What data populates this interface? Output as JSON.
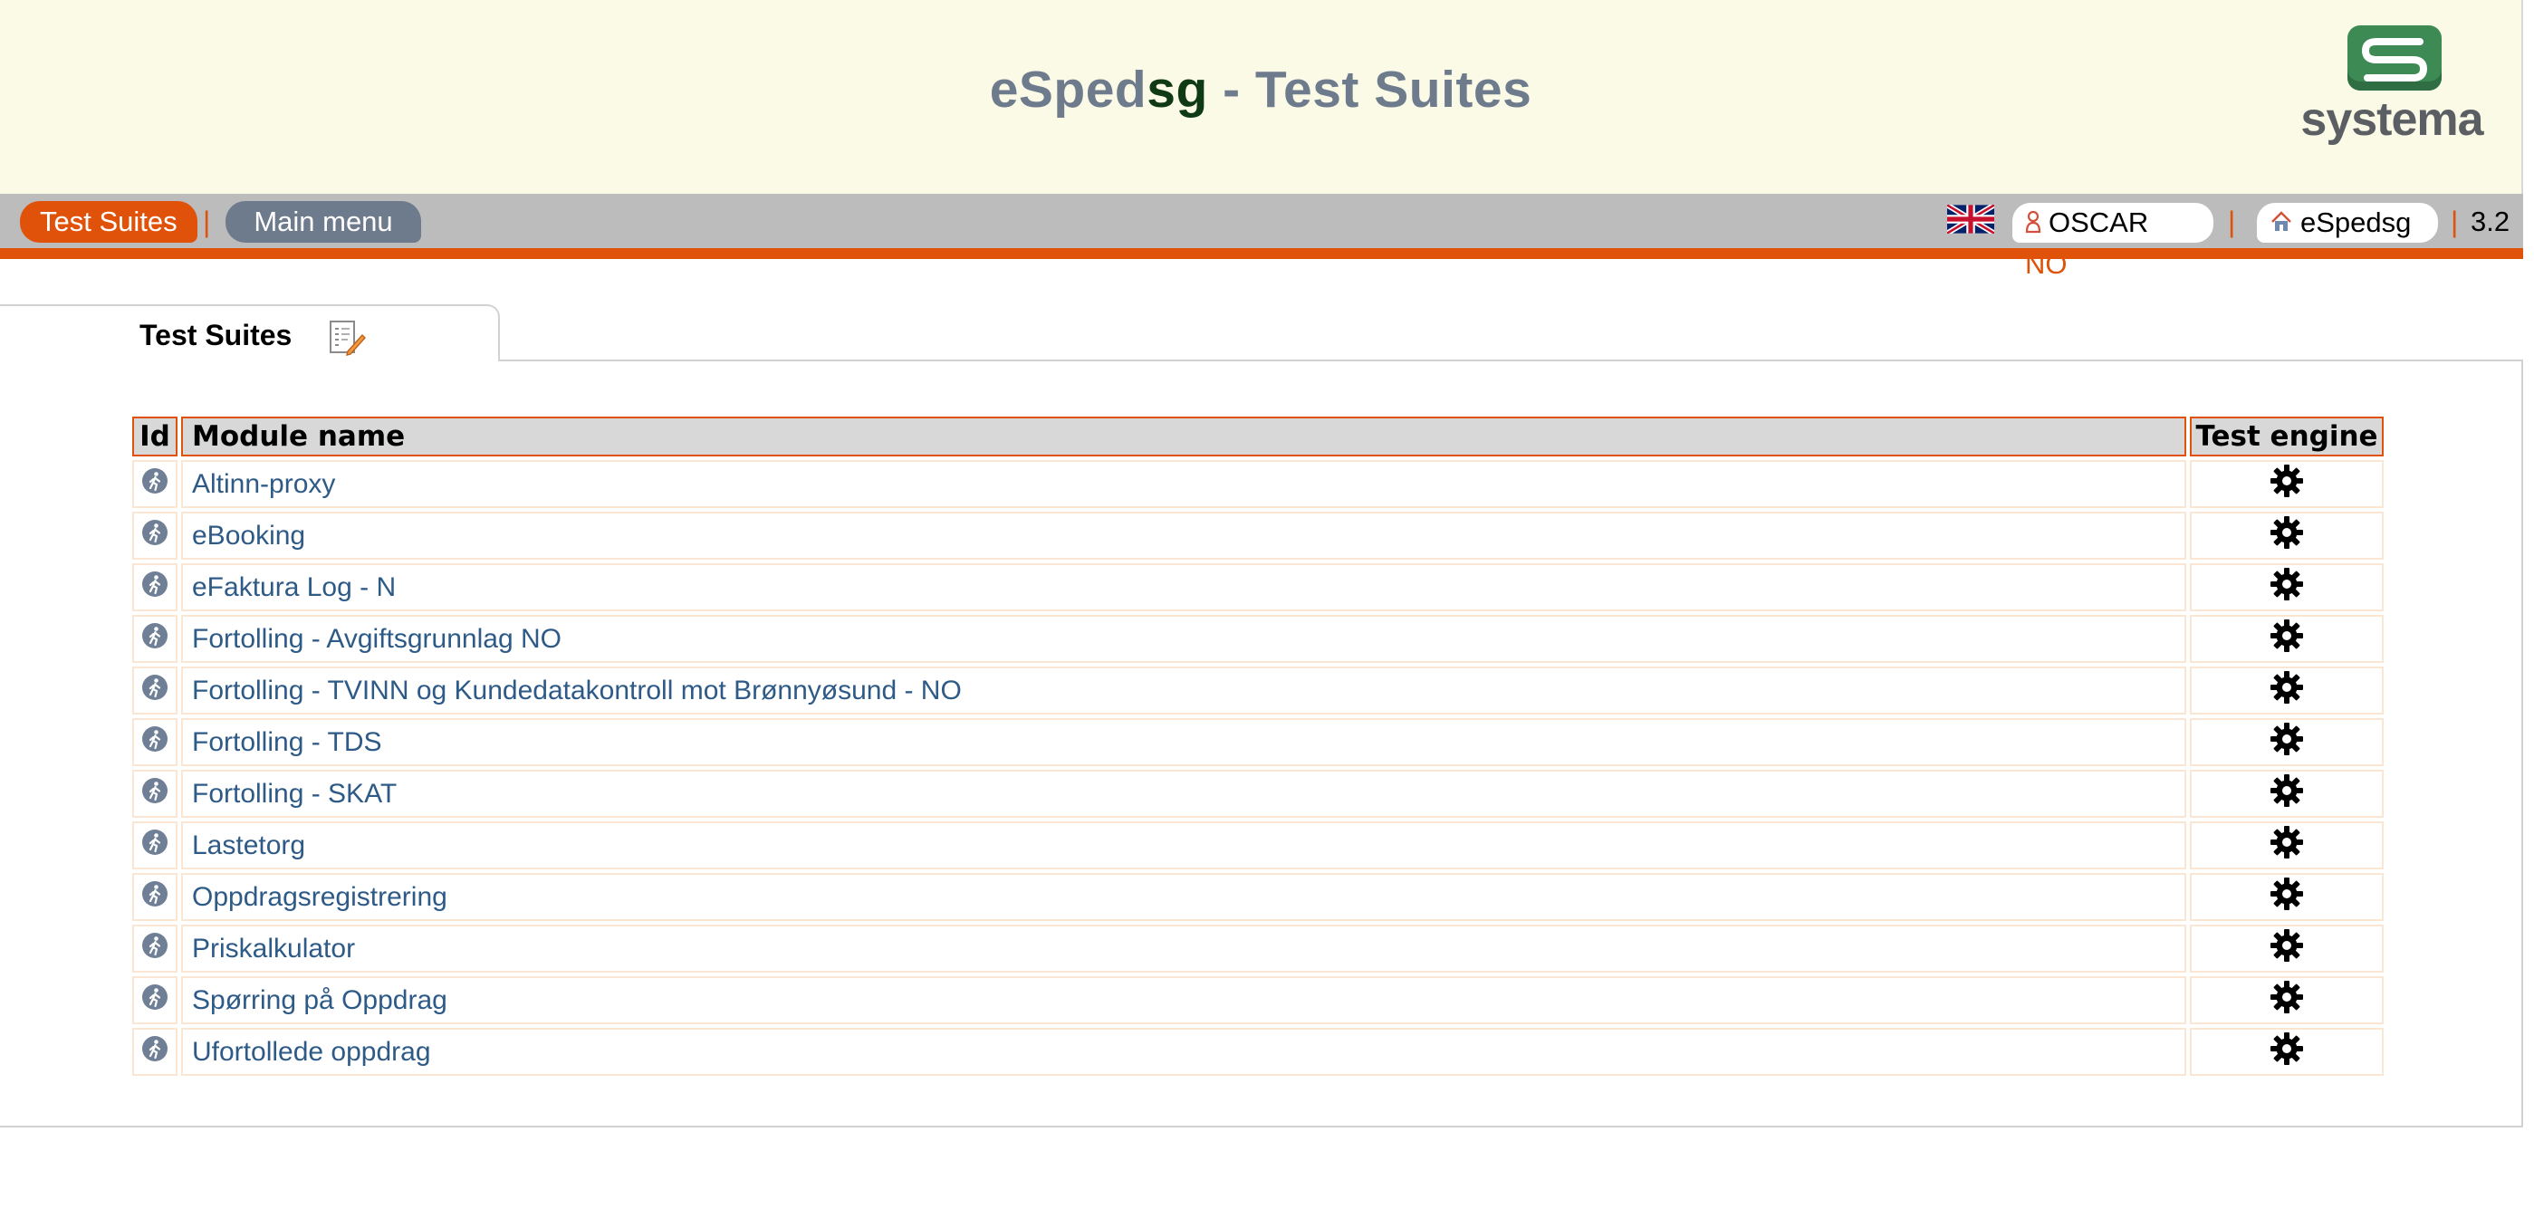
{
  "header": {
    "title_prefix": "eSped",
    "title_highlight": "sg",
    "title_suffix": " - Test Suites",
    "logo_text": "systema"
  },
  "nav": {
    "active_tab": "Test Suites",
    "separator": "|",
    "main_menu": "Main menu",
    "user_name": "OSCAR",
    "user_country": "NO",
    "app_name": "eSpedsg",
    "version": "3.2"
  },
  "content_tab": {
    "label": "Test Suites"
  },
  "table": {
    "headers": {
      "id": "Id",
      "module": "Module name",
      "engine": "Test engine"
    },
    "rows": [
      {
        "name": "Altinn-proxy"
      },
      {
        "name": "eBooking"
      },
      {
        "name": "eFaktura Log - N"
      },
      {
        "name": "Fortolling - Avgiftsgrunnlag NO"
      },
      {
        "name": "Fortolling - TVINN og Kundedatakontroll mot Brønnyøsund - NO"
      },
      {
        "name": "Fortolling - TDS"
      },
      {
        "name": "Fortolling - SKAT"
      },
      {
        "name": "Lastetorg"
      },
      {
        "name": "Oppdragsregistrering"
      },
      {
        "name": "Priskalkulator"
      },
      {
        "name": "Spørring på Oppdrag"
      },
      {
        "name": "Ufortollede oppdrag"
      }
    ]
  },
  "colors": {
    "accent": "#e0520a",
    "header_bg": "#fafae6",
    "nav_bg": "#bcbcbc",
    "link": "#2e5a87",
    "title_gray": "#6e7b8c",
    "title_green": "#0f3a14"
  },
  "icons": {
    "row": "running-man-icon",
    "engine": "gear-icon",
    "flag": "uk-flag-icon",
    "user": "user-icon",
    "home": "home-icon",
    "tab": "edit-document-icon"
  }
}
